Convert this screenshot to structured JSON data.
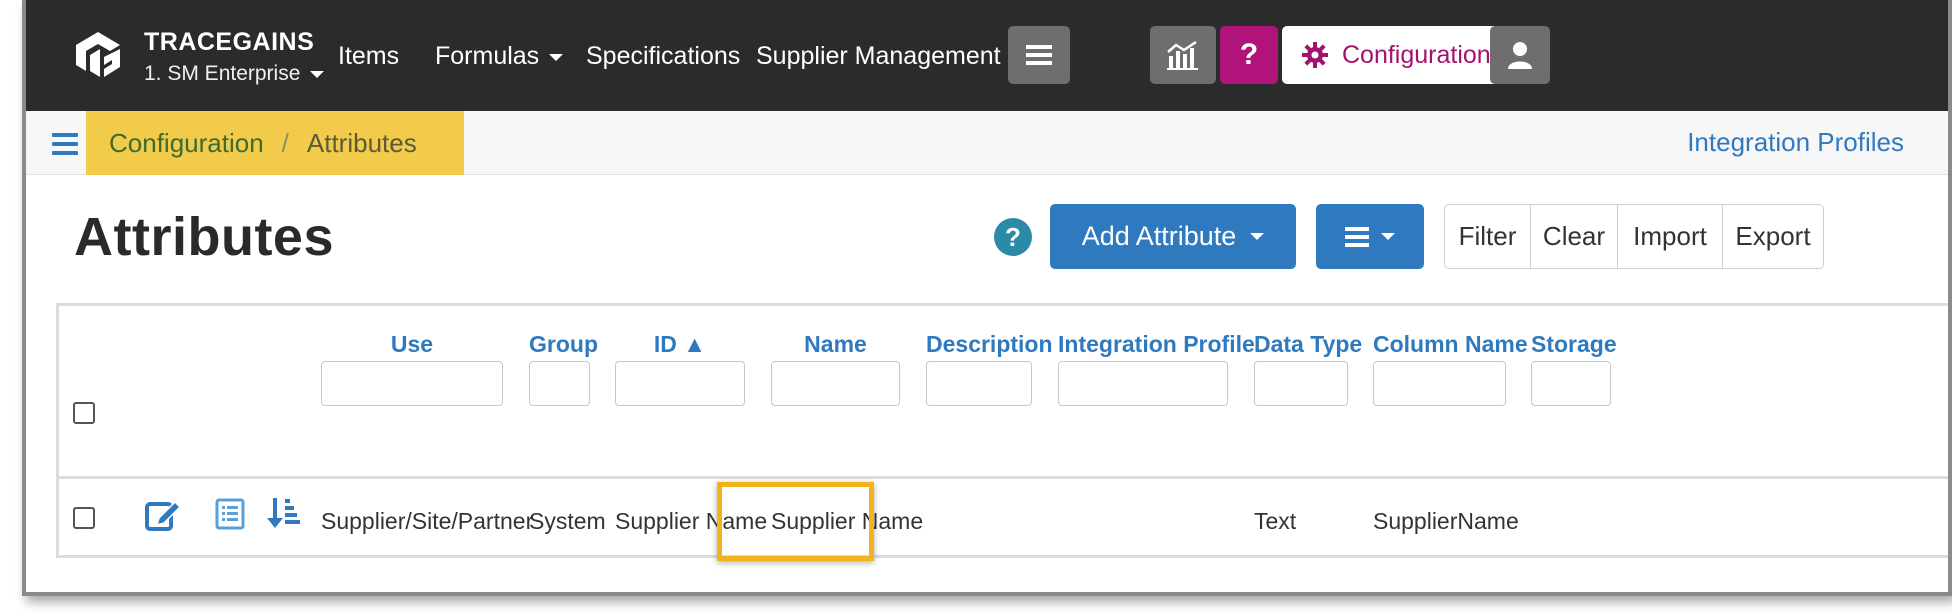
{
  "brand": {
    "name": "TRACEGAINS",
    "enterprise": "1. SM Enterprise"
  },
  "nav": {
    "items": [
      "Items",
      "Formulas",
      "Specifications",
      "Supplier Management"
    ],
    "configuration_label": "Configuration",
    "help_label": "?"
  },
  "breadcrumb": {
    "root": "Configuration",
    "separator": "/",
    "current": "Attributes"
  },
  "integration_profiles_link": "Integration Profiles",
  "page": {
    "title": "Attributes",
    "help_label": "?",
    "add_button": "Add Attribute",
    "actions": [
      "Filter",
      "Clear",
      "Import",
      "Export"
    ]
  },
  "grid": {
    "columns": [
      {
        "label": "Use"
      },
      {
        "label": "Group"
      },
      {
        "label": "ID ▲"
      },
      {
        "label": "Name"
      },
      {
        "label": "Description"
      },
      {
        "label": "Integration Profile"
      },
      {
        "label": "Data Type"
      },
      {
        "label": "Column Name"
      },
      {
        "label": "Storage"
      }
    ],
    "rows": [
      {
        "use": "Supplier/Site/Partner",
        "group": "System",
        "id": "Supplier Name",
        "name": "Supplier Name",
        "description": "",
        "integration_profile": "",
        "data_type": "Text",
        "column_name": "SupplierName"
      }
    ]
  },
  "colors": {
    "navbar": "#2b2b2b",
    "accent_blue": "#2f7abf",
    "magenta": "#b0147a",
    "breadcrumb_highlight": "#f3cb4b",
    "row_highlight": "#f2b31c"
  },
  "icons": [
    "tracegains-logo",
    "analytics-icon",
    "help-icon",
    "gear-icon",
    "user-icon",
    "hamburger-icon",
    "edit-icon",
    "list-icon",
    "sort-icon"
  ]
}
